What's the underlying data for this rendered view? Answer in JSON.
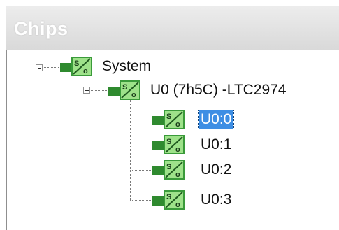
{
  "panel": {
    "title": "Chips"
  },
  "tree": {
    "root": {
      "label": "System",
      "icon": "ltc-chip-icon",
      "expanded": true
    },
    "chip": {
      "label": "U0 (7h5C) -LTC2974",
      "icon": "ltc-chip-icon",
      "expanded": true
    },
    "channels": [
      {
        "label": "U0:0",
        "selected": true
      },
      {
        "label": "U0:1",
        "selected": false
      },
      {
        "label": "U0:2",
        "selected": false
      },
      {
        "label": "U0:3",
        "selected": false
      }
    ]
  },
  "colors": {
    "icon_green_dark": "#2f8a2f",
    "icon_green_light": "#8fe07a",
    "selection": "#3d8ee4"
  }
}
